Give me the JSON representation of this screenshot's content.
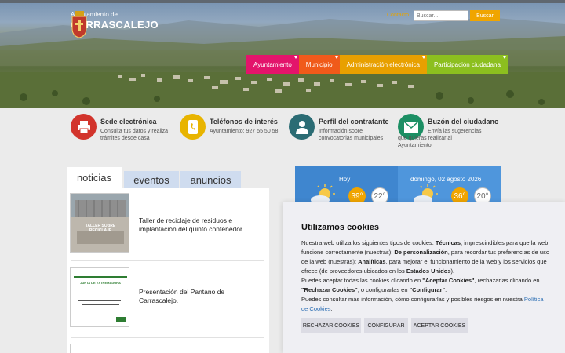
{
  "header": {
    "logo_small": "Ayuntamiento de",
    "logo_big": "CARRASCALEJO",
    "contact_label": "Contacto",
    "search_placeholder": "Buscar...",
    "search_button": "Buscar"
  },
  "nav": [
    {
      "label": "Ayuntamiento",
      "color": "#e3146b"
    },
    {
      "label": "Municipio",
      "color": "#f05a1a"
    },
    {
      "label": "Administración electrónica",
      "color": "#e8a000"
    },
    {
      "label": "Participación ciudadana",
      "color": "#8cbf1f"
    }
  ],
  "quick_links": [
    {
      "title": "Sede electrónica",
      "desc": "Consulta tus datos y realiza trámites desde casa",
      "icon": "printer-icon",
      "color": "#d2342c"
    },
    {
      "title": "Teléfonos de interés",
      "desc": "Ayuntamiento: 927 55 50 58",
      "icon": "phone-icon",
      "color": "#e8b400"
    },
    {
      "title": "Perfil del contratante",
      "desc": "Información sobre convocatorias municipales",
      "icon": "user-icon",
      "color": "#2b6c74"
    },
    {
      "title": "Buzón del ciudadano",
      "desc": "Envía las sugerencias que quieras realizar al Ayuntamiento",
      "icon": "mail-icon",
      "color": "#1c8f64"
    }
  ],
  "tabs": {
    "noticias": "noticias",
    "eventos": "eventos",
    "anuncios": "anuncios"
  },
  "news": [
    {
      "title": "Taller de reciclaje de residuos e implantación del quinto contenedor.",
      "thumb_caption": "TALLER SOBRE RECICLAJE"
    },
    {
      "title": "Presentación del Pantano de Carrascalejo.",
      "thumb_caption": "JUNTA DE EXTREMADURA"
    }
  ],
  "weather": {
    "today_label": "Hoy",
    "today_max": "39°",
    "today_min": "22°",
    "next_label": "domingo, 02 agosto 2026",
    "next_max": "36°",
    "next_min": "20°"
  },
  "cookies": {
    "title": "Utilizamos cookies",
    "p1a": "Nuestra web utiliza los siguientes tipos de cookies: ",
    "p1b": "Técnicas",
    "p1c": ", imprescindibles para que la web funcione correctamente (nuestras); ",
    "p1d": "De personalización",
    "p1e": ", para recordar tus preferencias de uso de la web (nuestras); ",
    "p1f": "Analíticas",
    "p1g": ", para mejorar el funcionamiento de la web y los servicios que ofrece (de proveedores ubicados en los ",
    "p1h": "Estados Unidos",
    "p1i": ").",
    "p2a": "Puedes aceptar todas las cookies clicando en ",
    "p2b": "\"Aceptar Cookies\"",
    "p2c": ", rechazarlas clicando en ",
    "p2d": "\"Rechazar Cookies\"",
    "p2e": ", o configurarlas en ",
    "p2f": "\"Configurar\"",
    "p2g": ".",
    "p3a": "Puedes consultar más información, cómo configurarlas y posibles riesgos en nuestra ",
    "p3b": "Política de Cookies",
    "p3c": ".",
    "btn_reject": "RECHAZAR COOKIES",
    "btn_config": "CONFIGURAR",
    "btn_accept": "ACEPTAR COOKIES"
  }
}
